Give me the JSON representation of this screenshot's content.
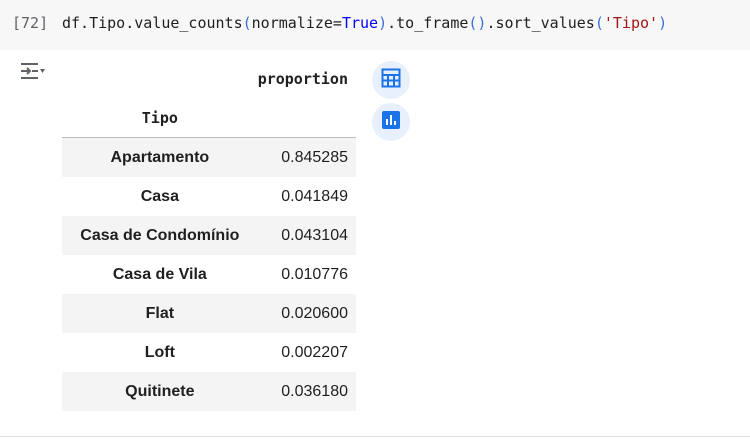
{
  "cell": {
    "exec_count": "[72]",
    "code": {
      "p1": "df.Tipo.value_counts",
      "p2": "(",
      "p3": "normalize=",
      "p4": "True",
      "p5": ")",
      "p6": ".to_frame",
      "p7": "()",
      "p8": ".sort_values",
      "p9": "(",
      "p10": "'Tipo'",
      "p11": ")"
    }
  },
  "output": {
    "toggle_icon": "output-collapse-icon",
    "column_header": "proportion",
    "index_name": "Tipo",
    "rows": [
      {
        "label": "Apartamento",
        "value": "0.845285"
      },
      {
        "label": "Casa",
        "value": "0.041849"
      },
      {
        "label": "Casa de Condomínio",
        "value": "0.043104"
      },
      {
        "label": "Casa de Vila",
        "value": "0.010776"
      },
      {
        "label": "Flat",
        "value": "0.020600"
      },
      {
        "label": "Loft",
        "value": "0.002207"
      },
      {
        "label": "Quitinete",
        "value": "0.036180"
      }
    ],
    "actions": [
      {
        "icon": "table-icon"
      },
      {
        "icon": "bar-chart-icon"
      }
    ]
  },
  "colors": {
    "accent": "#1a73e8",
    "fab_bg": "#e8f0fe",
    "keyword": "#0000ff",
    "string": "#a31515"
  }
}
